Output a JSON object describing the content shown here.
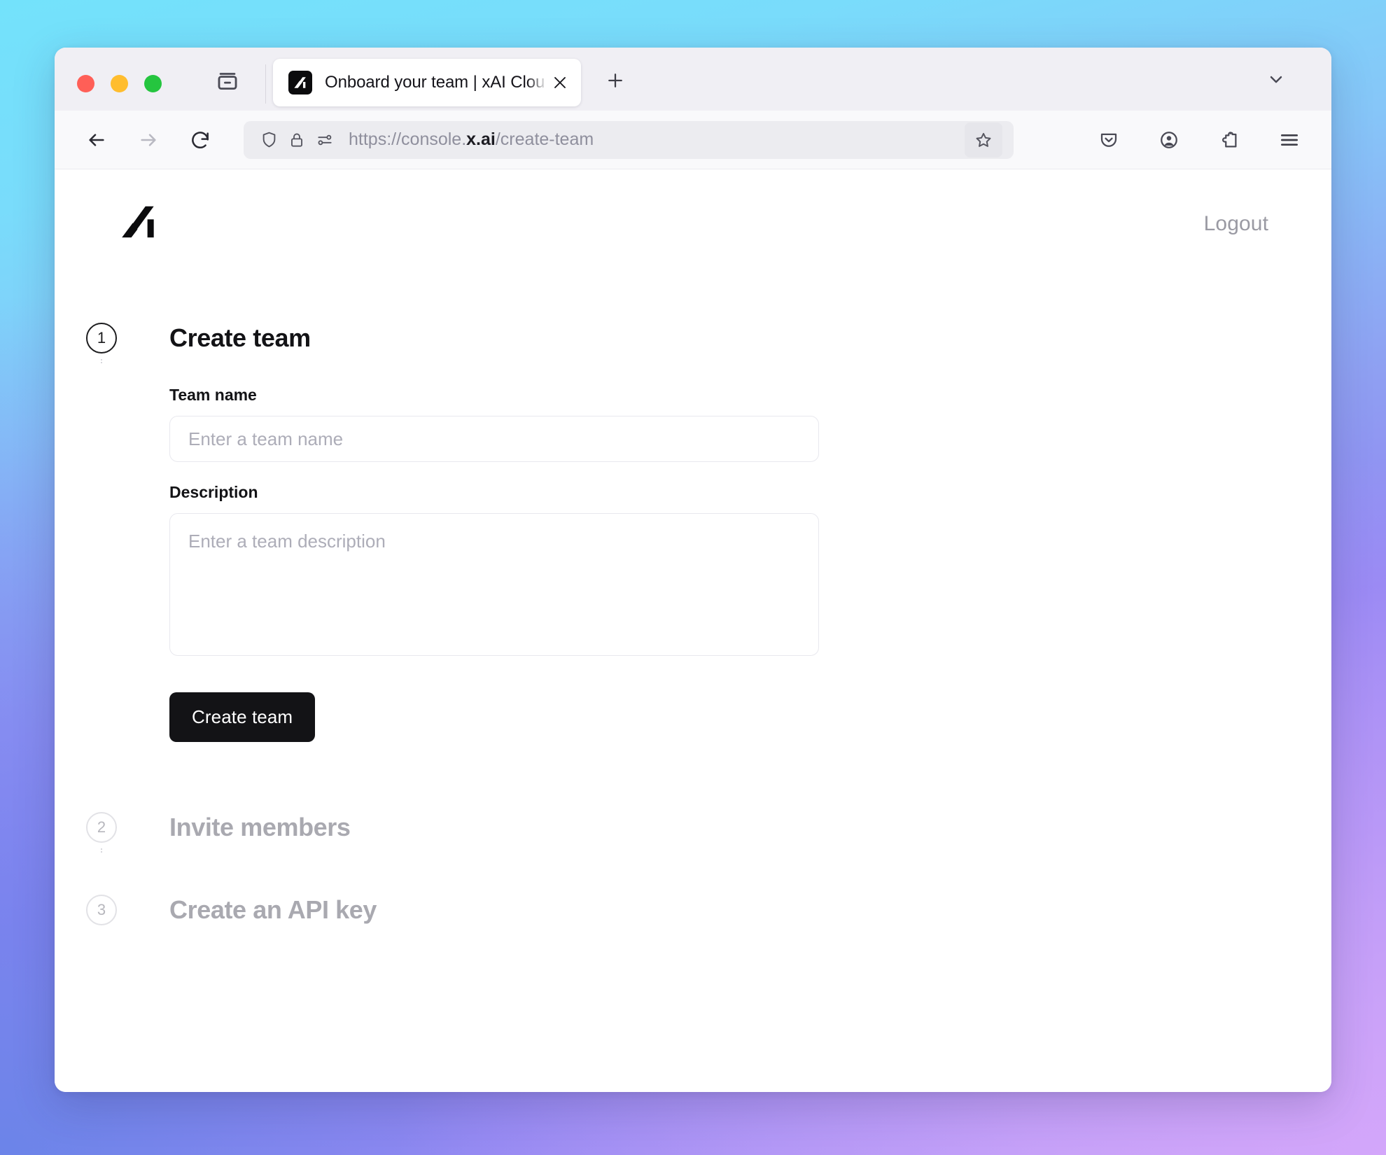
{
  "browser": {
    "traffic_lights": [
      "close",
      "minimize",
      "zoom"
    ],
    "tab": {
      "title": "Onboard your team | xAI Cloud C",
      "favicon": "xai-logo-icon",
      "close_icon": "close-icon"
    },
    "new_tab_icon": "plus-icon",
    "list_all_tabs_icon": "chevron-down-icon",
    "sidebar_toggle_icon": "sidebar-icon",
    "nav": {
      "back_icon": "arrow-left-icon",
      "forward_icon": "arrow-right-icon",
      "reload_icon": "reload-icon"
    },
    "url": {
      "shield_icon": "shield-icon",
      "lock_icon": "lock-icon",
      "permissions_icon": "page-settings-icon",
      "prefix": "https://console.",
      "domain": "x.ai",
      "path": "/create-team",
      "full": "https://console.x.ai/create-team",
      "bookmark_icon": "star-icon"
    },
    "toolbar_icons": [
      "pocket-icon",
      "account-icon",
      "extensions-icon",
      "menu-icon"
    ]
  },
  "page": {
    "logo": "xai-logo",
    "logout_label": "Logout",
    "steps": [
      {
        "number": "1",
        "title": "Create team",
        "active": true,
        "fields": [
          {
            "label": "Team name",
            "placeholder": "Enter a team name",
            "value": ""
          },
          {
            "label": "Description",
            "placeholder": "Enter a team description",
            "value": ""
          }
        ],
        "submit_label": "Create team"
      },
      {
        "number": "2",
        "title": "Invite members",
        "active": false
      },
      {
        "number": "3",
        "title": "Create an API key",
        "active": false
      }
    ]
  },
  "colors": {
    "accent_button": "#131316",
    "muted_text": "#a9a9b0",
    "placeholder": "#adadb8",
    "bg_gradient_start": "#73e2fb",
    "bg_gradient_mid": "#8f9ff2",
    "bg_gradient_end": "#c3a4f5"
  }
}
